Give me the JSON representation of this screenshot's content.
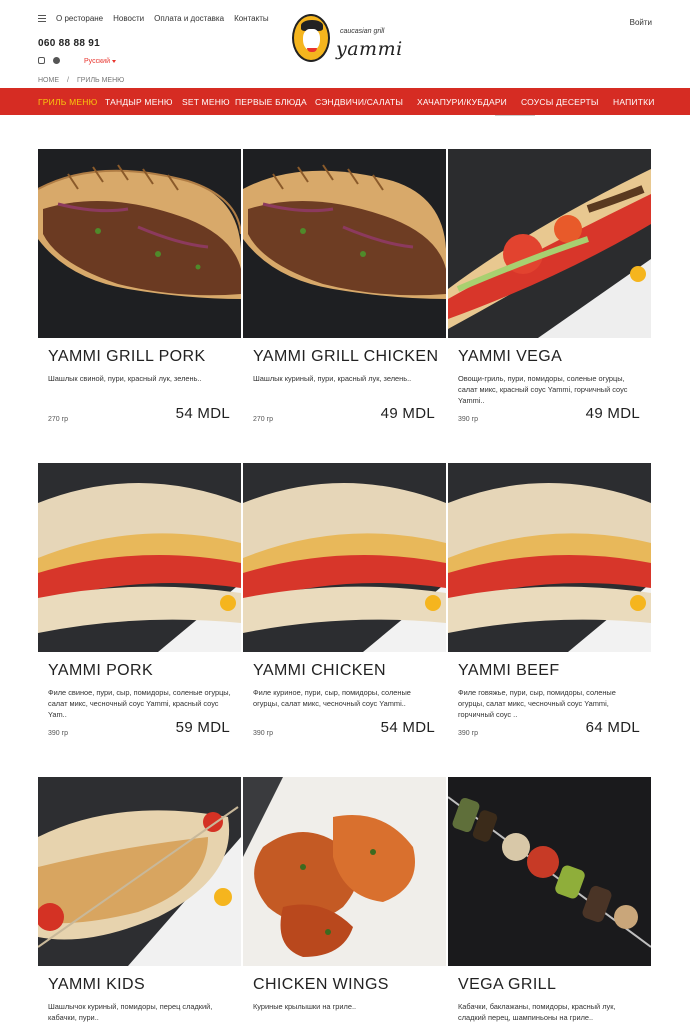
{
  "header": {
    "nav": [
      "О ресторане",
      "Новости",
      "Оплата и доставка",
      "Контакты"
    ],
    "phone": "060 88 88 91",
    "language": "Русский",
    "login": "Войти",
    "breadcrumb": [
      "HOME",
      "/",
      "ГРИЛЬ МЕНЮ"
    ],
    "logo_subtitle": "caucasian grill",
    "logo_title": "yammi"
  },
  "menu": [
    {
      "label": "ГРИЛЬ МЕНЮ",
      "active": true
    },
    {
      "label": "ТАНДЫР МЕНЮ"
    },
    {
      "label": "SET МЕНЮ"
    },
    {
      "label": "ПЕРВЫЕ БЛЮДА"
    },
    {
      "label": "СЭНДВИЧИ/САЛАТЫ"
    },
    {
      "label": "ХАЧАПУРИ/КУБДАРИ"
    },
    {
      "label": "СОУСЫ"
    },
    {
      "label": "ДЕСЕРТЫ"
    },
    {
      "label": "НАПИТКИ"
    }
  ],
  "colors": {
    "brand_red": "#d62c23",
    "active_menu": "#f9c80e",
    "logo_yellow": "#f5b51e"
  },
  "products": [
    {
      "name": "YAMMI GRILL PORK",
      "desc": "Шашлык свиной, пури, красный лук, зелень..",
      "weight": "270 гр",
      "price": "54 MDL",
      "image": "pita-dark"
    },
    {
      "name": "YAMMI GRILL CHICKEN",
      "desc": "Шашлык куриный, пури, красный лук, зелень..",
      "weight": "270 гр",
      "price": "49 MDL",
      "image": "pita-dark"
    },
    {
      "name": "YAMMI VEGA",
      "desc": "Овощи-гриль, пури, помидоры, соленые огурцы, салат микс, красный соус Yammi, горчичный соус Yammi..",
      "weight": "390 гр",
      "price": "49 MDL",
      "image": "pita-veg"
    },
    {
      "name": "YAMMI PORK",
      "desc": "Филе свиное, пури, сыр, помидоры, соленые огурцы, салат микс, чесночный соус Yammi, красный соус Yam..",
      "weight": "390 гр",
      "price": "59 MDL",
      "image": "pita-wrap"
    },
    {
      "name": "YAMMI CHICKEN",
      "desc": "Филе куриное, пури, сыр, помидоры, соленые огурцы, салат микс, чесночный соус Yammi..",
      "weight": "390 гр",
      "price": "54 MDL",
      "image": "pita-wrap"
    },
    {
      "name": "YAMMI BEEF",
      "desc": "Филе говяжье, пури, сыр, помидоры, соленые огурцы, салат микс, чесночный соус Yammi, горчичный соус ..",
      "weight": "390 гр",
      "price": "64 MDL",
      "image": "pita-wrap"
    },
    {
      "name": "YAMMI KIDS",
      "desc": "Шашлычок куриный, помидоры, перец сладкий, кабачки, пури..",
      "weight": "",
      "price": "",
      "image": "kids"
    },
    {
      "name": "CHICKEN WINGS",
      "desc": "Куриные крылышки на гриле..",
      "weight": "",
      "price": "",
      "image": "wings"
    },
    {
      "name": "VEGA GRILL",
      "desc": "Кабачки, баклажаны, помидоры, красный лук, сладкий перец, шампиньоны на гриле..",
      "weight": "",
      "price": "",
      "image": "skewer"
    }
  ]
}
